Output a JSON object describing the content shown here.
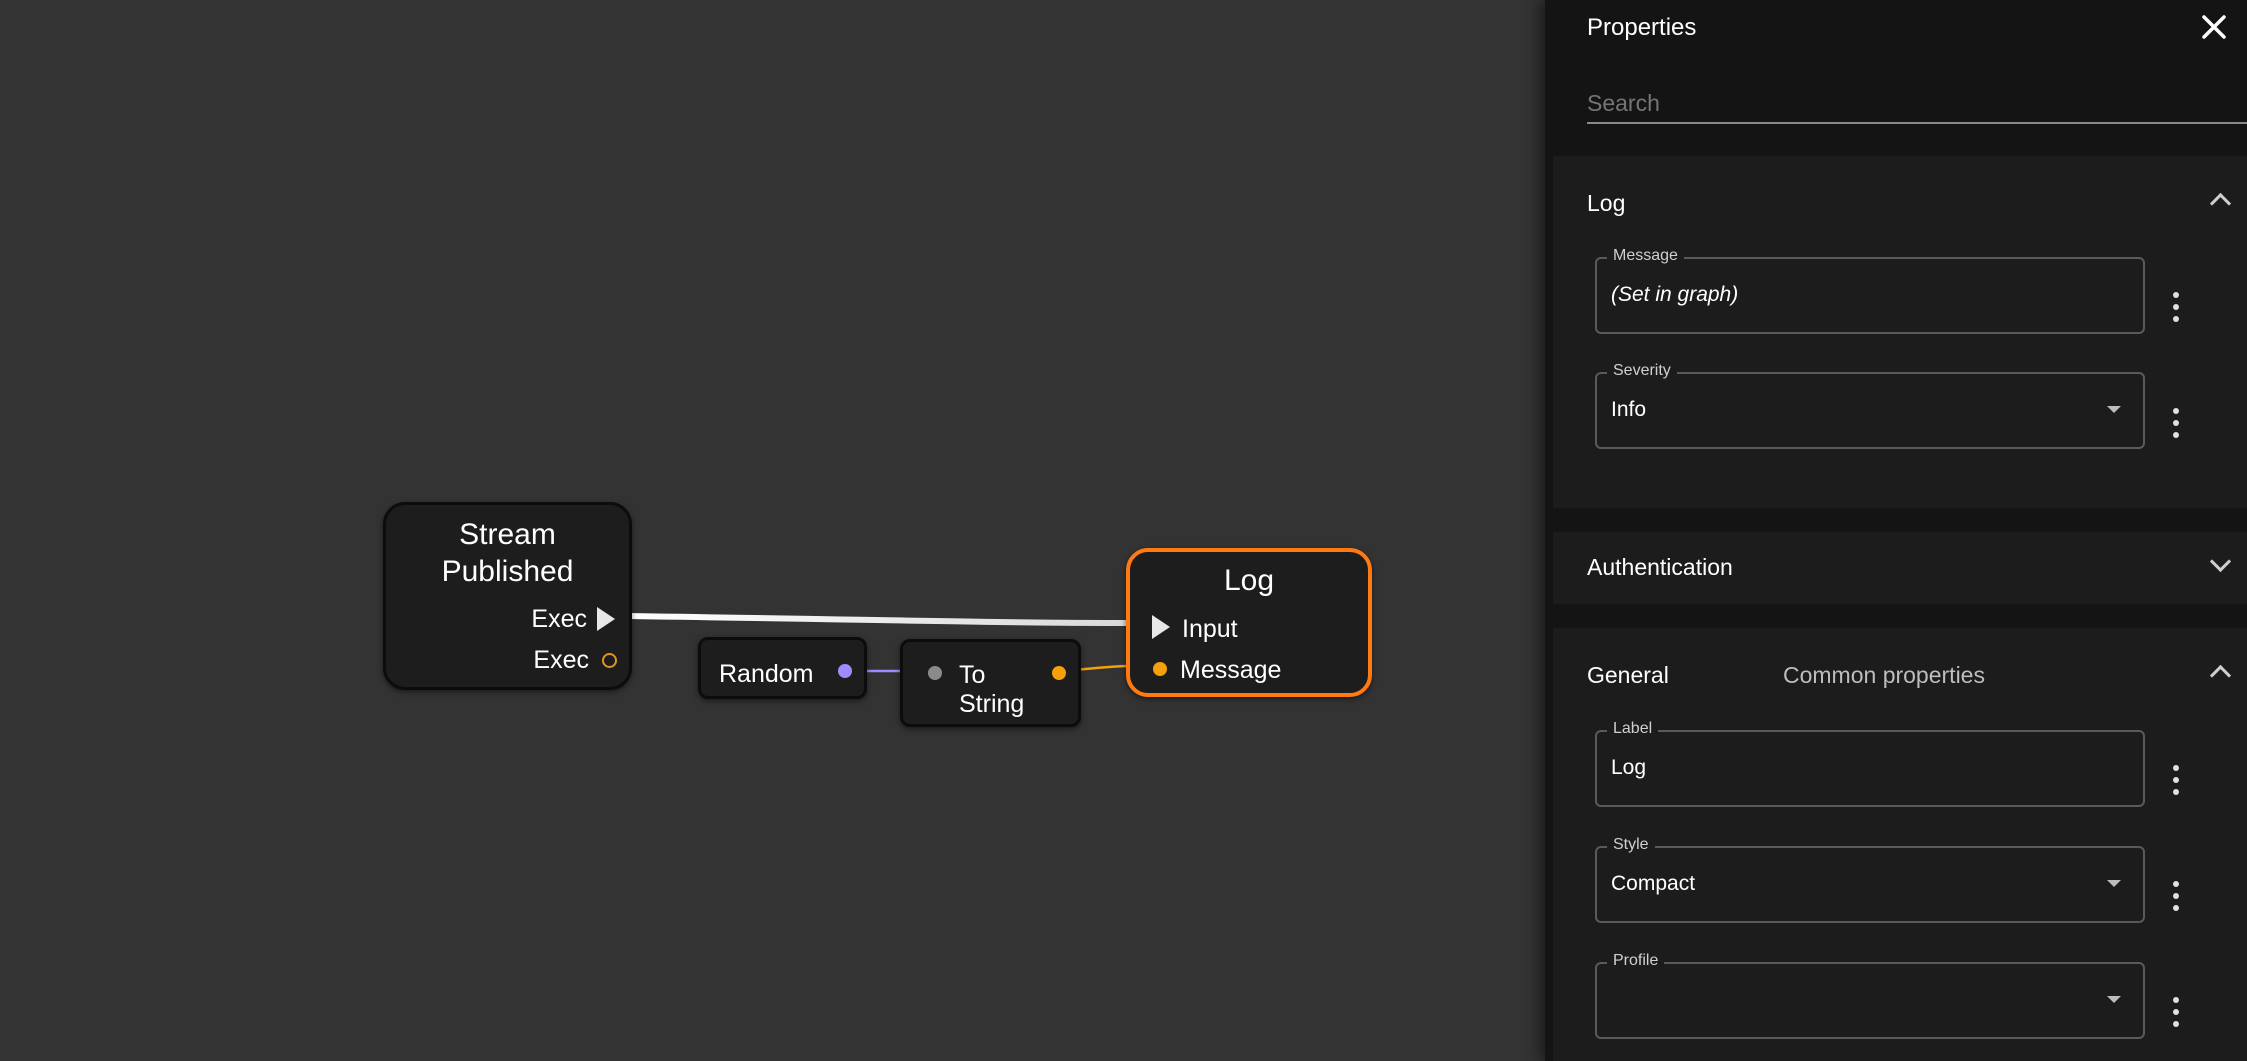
{
  "graph": {
    "nodes": {
      "stream_published": {
        "title_line1": "Stream",
        "title_line2": "Published",
        "pin_exec_out": "Exec",
        "pin_exec_ring": "Exec"
      },
      "random": {
        "title": "Random"
      },
      "to_string": {
        "title_line1": "To",
        "title_line2": "String"
      },
      "log": {
        "title": "Log",
        "pin_input": "Input",
        "pin_message": "Message"
      }
    },
    "colors": {
      "exec_wire": "#e6e6e6",
      "number_pin": "#9d8cff",
      "string_pin": "#f5a00a",
      "any_pin": "#8a8a8a",
      "selected_border": "#ff7a12"
    }
  },
  "panel": {
    "title": "Properties",
    "close_icon": "close-icon",
    "search_placeholder": "Search",
    "sections": {
      "log": {
        "title": "Log",
        "expanded": true,
        "message": {
          "label": "Message",
          "value": "(Set in graph)"
        },
        "severity": {
          "label": "Severity",
          "value": "Info"
        }
      },
      "authentication": {
        "title": "Authentication",
        "expanded": false
      },
      "general": {
        "title": "General",
        "subtitle": "Common properties",
        "expanded": true,
        "label": {
          "label": "Label",
          "value": "Log"
        },
        "style": {
          "label": "Style",
          "value": "Compact"
        },
        "profile": {
          "label": "Profile",
          "value": ""
        }
      }
    }
  }
}
